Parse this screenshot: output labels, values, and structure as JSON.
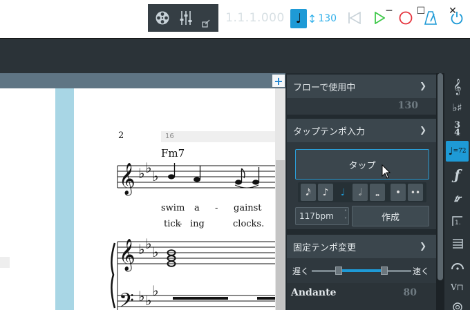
{
  "window": {
    "minimize": "─",
    "maximize": "☐",
    "close": "✕"
  },
  "toolbar": {
    "position": "1.1.1.000",
    "tempo_value": "130",
    "tempo_arrow": "↕"
  },
  "score": {
    "measure_number": "2",
    "bar_number_box": "16",
    "chord": "Fm7",
    "lyrics_line1": [
      "swim",
      "a",
      "-",
      "gainst"
    ],
    "lyrics_line2": [
      "tick",
      "-",
      "ing",
      "clocks."
    ]
  },
  "panel": {
    "flow_section": {
      "title": "フローで使用中",
      "value": "130"
    },
    "tap_section": {
      "title": "タップテンポ入力",
      "tap_label": "タップ",
      "bpm_value": "117bpm",
      "create_label": "作成"
    },
    "fixed_section": {
      "title": "固定テンポ変更",
      "slow_label": "遅く",
      "fast_label": "速く",
      "tempo_name": "Andante",
      "tempo_value": "80"
    }
  },
  "strip": {
    "tempo_badge": "=72"
  },
  "colors": {
    "accent": "#1e9ad6",
    "panel": "#222a2f",
    "header": "#3b464d",
    "green": "#3fc84a",
    "red": "#e5323c"
  },
  "icons": [
    "film-reel-icon",
    "mixer-icon",
    "window-icon",
    "rewind-icon",
    "play-icon",
    "record-icon",
    "metronome-icon",
    "power-icon"
  ]
}
